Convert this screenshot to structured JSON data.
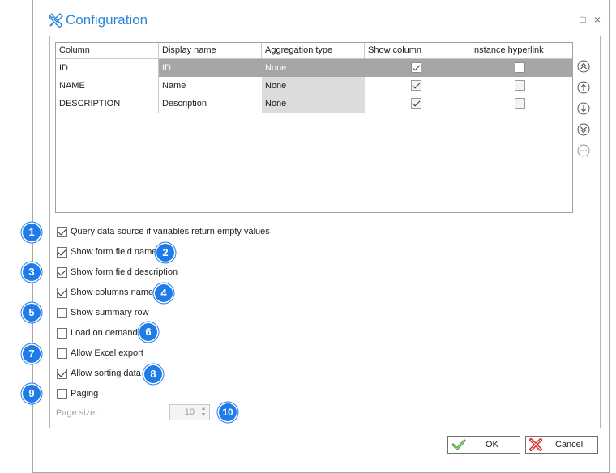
{
  "window": {
    "title": "Configuration",
    "maximize_glyph": "□",
    "close_glyph": "×"
  },
  "grid": {
    "headers": [
      "Column",
      "Display name",
      "Aggregation type",
      "Show column",
      "Instance hyperlink"
    ],
    "rows": [
      {
        "column": "ID",
        "display_name": "ID",
        "aggregation": "None",
        "show_column": true,
        "instance_hyperlink": false,
        "selected": true
      },
      {
        "column": "NAME",
        "display_name": "Name",
        "aggregation": "None",
        "show_column": true,
        "instance_hyperlink": false,
        "selected": false
      },
      {
        "column": "DESCRIPTION",
        "display_name": "Description",
        "aggregation": "None",
        "show_column": true,
        "instance_hyperlink": false,
        "selected": false
      }
    ]
  },
  "side_buttons": [
    "move-to-top-icon",
    "move-up-icon",
    "move-down-icon",
    "move-to-bottom-icon",
    "more-icon"
  ],
  "options": [
    {
      "label": "Query data source if variables return empty values",
      "checked": true,
      "badge": "1"
    },
    {
      "label": "Show form field name",
      "checked": true,
      "badge": "2"
    },
    {
      "label": "Show form field description",
      "checked": true,
      "badge": "3"
    },
    {
      "label": "Show columns names",
      "checked": true,
      "badge": "4"
    },
    {
      "label": "Show summary row",
      "checked": false,
      "badge": "5"
    },
    {
      "label": "Load on demand",
      "checked": false,
      "badge": "6"
    },
    {
      "label": "Allow Excel export",
      "checked": false,
      "badge": "7"
    },
    {
      "label": "Allow sorting data",
      "checked": true,
      "badge": "8"
    },
    {
      "label": "Paging",
      "checked": false,
      "badge": "9"
    }
  ],
  "page_size": {
    "label": "Page size:",
    "value": "10",
    "badge": "10"
  },
  "buttons": {
    "ok": "OK",
    "cancel": "Cancel"
  },
  "colors": {
    "accent": "#2b88d8",
    "badge": "#1f7be8",
    "selected_row": "#a6a6a6",
    "aggregation_cell": "#dcdcdc",
    "ok_icon": "#3a9a2e",
    "cancel_icon": "#d42a2a"
  },
  "icons": {
    "title": "tools-icon",
    "ok": "checkmark-icon",
    "cancel": "x-icon"
  }
}
